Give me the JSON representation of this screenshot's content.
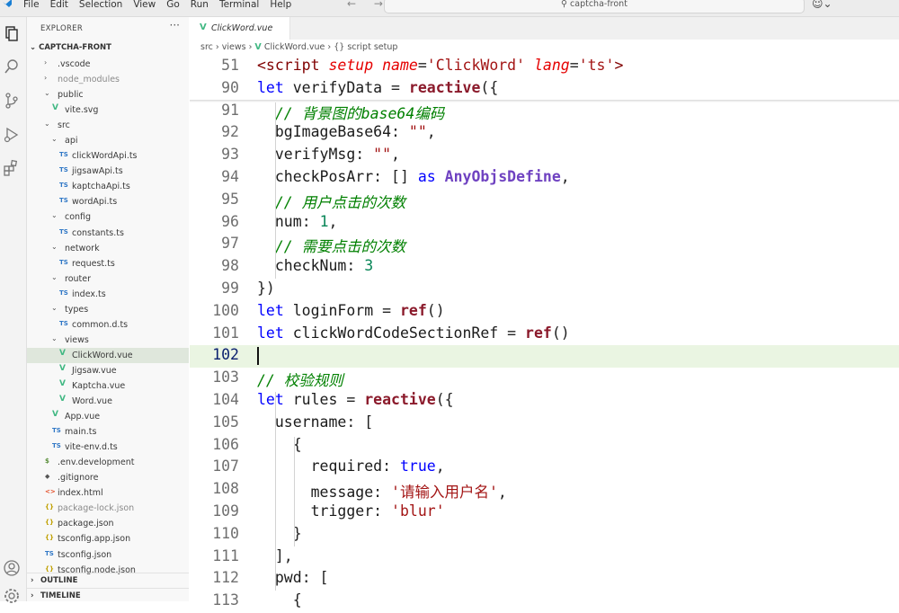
{
  "titlebar": {
    "menu": [
      "File",
      "Edit",
      "Selection",
      "View",
      "Go",
      "Run",
      "Terminal",
      "Help"
    ],
    "back_arrow": "←",
    "forward_arrow": "→",
    "search_text": "captcha-front"
  },
  "sidebar": {
    "title": "EXPLORER",
    "more": "···",
    "root": "CAPTCHA-FRONT",
    "sections": [
      "OUTLINE",
      "TIMELINE"
    ],
    "tree": [
      {
        "label": ".vscode",
        "type": "folder",
        "open": false,
        "depth": 1
      },
      {
        "label": "node_modules",
        "type": "folder",
        "open": false,
        "depth": 1,
        "dim": true
      },
      {
        "label": "public",
        "type": "folder",
        "open": true,
        "depth": 1
      },
      {
        "label": "vite.svg",
        "type": "vue",
        "depth": 2
      },
      {
        "label": "src",
        "type": "folder",
        "open": true,
        "depth": 1
      },
      {
        "label": "api",
        "type": "folder",
        "open": true,
        "depth": 2
      },
      {
        "label": "clickWordApi.ts",
        "type": "ts",
        "depth": 3
      },
      {
        "label": "jigsawApi.ts",
        "type": "ts",
        "depth": 3
      },
      {
        "label": "kaptchaApi.ts",
        "type": "ts",
        "depth": 3
      },
      {
        "label": "wordApi.ts",
        "type": "ts",
        "depth": 3
      },
      {
        "label": "config",
        "type": "folder",
        "open": true,
        "depth": 2
      },
      {
        "label": "constants.ts",
        "type": "ts",
        "depth": 3
      },
      {
        "label": "network",
        "type": "folder",
        "open": true,
        "depth": 2
      },
      {
        "label": "request.ts",
        "type": "ts",
        "depth": 3
      },
      {
        "label": "router",
        "type": "folder",
        "open": true,
        "depth": 2
      },
      {
        "label": "index.ts",
        "type": "ts",
        "depth": 3
      },
      {
        "label": "types",
        "type": "folder",
        "open": true,
        "depth": 2
      },
      {
        "label": "common.d.ts",
        "type": "ts",
        "depth": 3
      },
      {
        "label": "views",
        "type": "folder",
        "open": true,
        "depth": 2
      },
      {
        "label": "ClickWord.vue",
        "type": "vue",
        "depth": 3,
        "selected": true
      },
      {
        "label": "Jigsaw.vue",
        "type": "vue",
        "depth": 3
      },
      {
        "label": "Kaptcha.vue",
        "type": "vue",
        "depth": 3
      },
      {
        "label": "Word.vue",
        "type": "vue",
        "depth": 3
      },
      {
        "label": "App.vue",
        "type": "vue",
        "depth": 2
      },
      {
        "label": "main.ts",
        "type": "ts",
        "depth": 2
      },
      {
        "label": "vite-env.d.ts",
        "type": "ts",
        "depth": 2
      },
      {
        "label": ".env.development",
        "type": "env",
        "depth": 1
      },
      {
        "label": ".gitignore",
        "type": "git",
        "depth": 1
      },
      {
        "label": "index.html",
        "type": "html",
        "depth": 1
      },
      {
        "label": "package-lock.json",
        "type": "json",
        "depth": 1,
        "dim": true
      },
      {
        "label": "package.json",
        "type": "json",
        "depth": 1
      },
      {
        "label": "tsconfig.app.json",
        "type": "json",
        "depth": 1
      },
      {
        "label": "tsconfig.json",
        "type": "tsjson",
        "depth": 1
      },
      {
        "label": "tsconfig.node.json",
        "type": "json",
        "depth": 1
      }
    ]
  },
  "icons": {
    "ts": "TS",
    "vue": "V",
    "json": "{}",
    "html": "<>",
    "env": "$",
    "git": "◆",
    "tsjson": "TS"
  },
  "editor": {
    "tab_label": "ClickWord.vue",
    "breadcrumb": [
      "src",
      "views",
      "ClickWord.vue",
      "{} script setup"
    ],
    "lines": [
      {
        "n": "51",
        "html": "<span class='tag'>&lt;script</span> <span class='attr'>setup</span> <span class='attr'>name</span>=<span class='str'>'ClickWord'</span> <span class='attr'>lang</span>=<span class='str'>'ts'</span><span class='tag'>&gt;</span>"
      },
      {
        "n": "90",
        "html": "<span class='kw'>let</span> <span class='ident'>verifyData</span> = <span class='fn'>reactive</span>({"
      },
      {
        "n": "91",
        "html": "  <span class='cm'>// 背景图的base64编码</span>"
      },
      {
        "n": "92",
        "html": "  <span class='ident'>bgImageBase64</span>: <span class='str'>\"\"</span>,"
      },
      {
        "n": "93",
        "html": "  <span class='ident'>verifyMsg</span>: <span class='str'>\"\"</span>,"
      },
      {
        "n": "94",
        "html": "  <span class='ident'>checkPosArr</span>: [] <span class='kw'>as</span> <span class='type'>AnyObjsDefine</span>,"
      },
      {
        "n": "95",
        "html": "  <span class='cm'>// 用户点击的次数</span>"
      },
      {
        "n": "96",
        "html": "  <span class='ident'>num</span>: <span class='num'>1</span>,"
      },
      {
        "n": "97",
        "html": "  <span class='cm'>// 需要点击的次数</span>"
      },
      {
        "n": "98",
        "html": "  <span class='ident'>checkNum</span>: <span class='num'>3</span>"
      },
      {
        "n": "99",
        "html": "})"
      },
      {
        "n": "100",
        "html": "<span class='kw'>let</span> <span class='ident'>loginForm</span> = <span class='fn'>ref</span>()"
      },
      {
        "n": "101",
        "html": "<span class='kw'>let</span> <span class='ident'>clickWordCodeSectionRef</span> = <span class='fn'>ref</span>()"
      },
      {
        "n": "102",
        "html": "",
        "current": true
      },
      {
        "n": "103",
        "html": "<span class='cm'>// 校验规则</span>"
      },
      {
        "n": "104",
        "html": "<span class='kw'>let</span> <span class='ident'>rules</span> = <span class='fn'>reactive</span>({"
      },
      {
        "n": "105",
        "html": "  <span class='ident'>username</span>: ["
      },
      {
        "n": "106",
        "html": "    {"
      },
      {
        "n": "107",
        "html": "      <span class='ident'>required</span>: <span class='kw'>true</span>,"
      },
      {
        "n": "108",
        "html": "      <span class='ident'>message</span>: <span class='str'>'请输入用户名'</span>,"
      },
      {
        "n": "109",
        "html": "      <span class='ident'>trigger</span>: <span class='str'>'blur'</span>"
      },
      {
        "n": "110",
        "html": "    }"
      },
      {
        "n": "111",
        "html": "  ],"
      },
      {
        "n": "112",
        "html": "  <span class='ident'>pwd</span>: ["
      },
      {
        "n": "113",
        "html": "    {"
      }
    ]
  }
}
